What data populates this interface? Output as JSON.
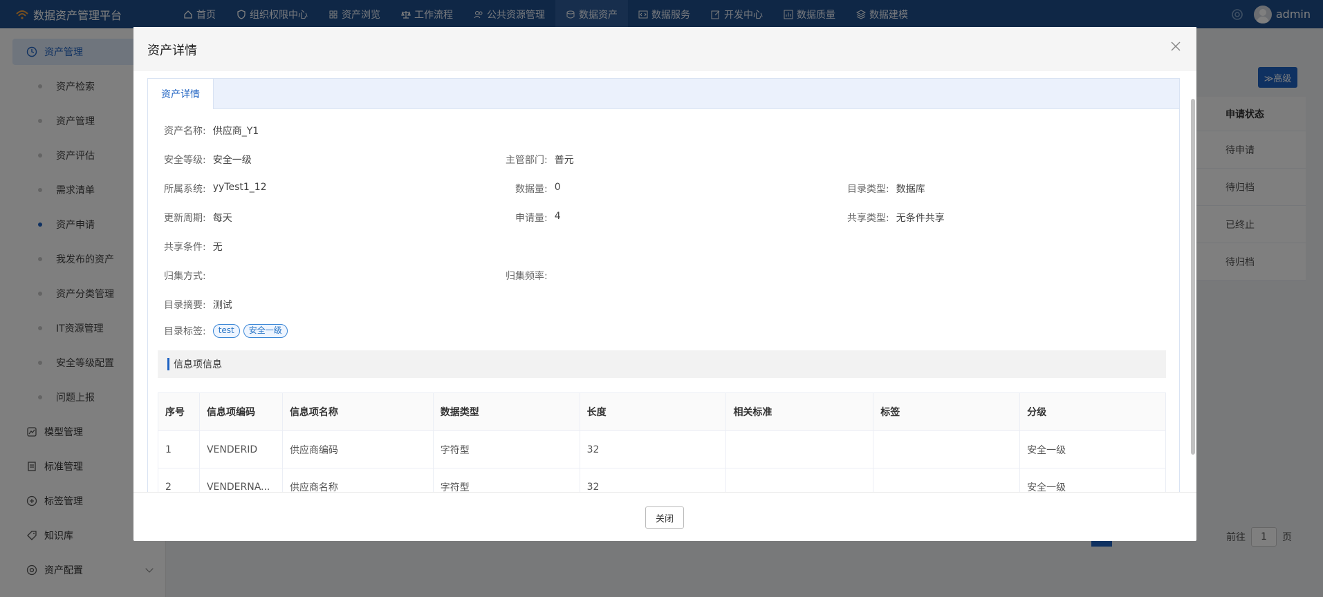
{
  "app": {
    "title": "数据资产管理平台",
    "user": "admin"
  },
  "topnav": [
    {
      "label": "首页",
      "icon": "home-icon"
    },
    {
      "label": "组织权限中心",
      "icon": "shield-icon"
    },
    {
      "label": "资产浏览",
      "icon": "grid-icon"
    },
    {
      "label": "工作流程",
      "icon": "scale-icon"
    },
    {
      "label": "公共资源管理",
      "icon": "users-icon"
    },
    {
      "label": "数据资产",
      "icon": "database-icon",
      "active": true
    },
    {
      "label": "数据服务",
      "icon": "code-icon"
    },
    {
      "label": "开发中心",
      "icon": "edit-icon"
    },
    {
      "label": "数据质量",
      "icon": "chart-icon"
    },
    {
      "label": "数据建模",
      "icon": "layers-icon"
    }
  ],
  "sidebar": {
    "group_active": "资产管理",
    "subitems": [
      "资产检索",
      "资产管理",
      "资产评估",
      "需求清单",
      "资产申请",
      "我发布的资产",
      "资产分类管理",
      "IT资源管理",
      "安全等级配置",
      "问题上报"
    ],
    "groups": [
      "模型管理",
      "标准管理",
      "标签管理",
      "知识库",
      "资产配置"
    ]
  },
  "background": {
    "advanced_label": "≫高级",
    "status_header": "申请状态",
    "statuses": [
      "待申请",
      "待归档",
      "已终止",
      "待归档"
    ],
    "pager_goto": "前往",
    "pager_page": "1",
    "pager_suffix": "页"
  },
  "modal": {
    "title": "资产详情",
    "tab": "资产详情",
    "close_button": "关闭",
    "fields": {
      "name_label": "资产名称:",
      "name_value": "供应商_Y1",
      "security_label": "安全等级:",
      "security_value": "安全一级",
      "dept_label": "主管部门:",
      "dept_value": "普元",
      "system_label": "所属系统:",
      "system_value": "yyTest1_12",
      "datacount_label": "数据量:",
      "datacount_value": "0",
      "cattype_label": "目录类型:",
      "cattype_value": "数据库",
      "cycle_label": "更新周期:",
      "cycle_value": "每天",
      "apply_label": "申请量:",
      "apply_value": "4",
      "sharetype_label": "共享类型:",
      "sharetype_value": "无条件共享",
      "sharecond_label": "共享条件:",
      "sharecond_value": "无",
      "collect_label": "归集方式:",
      "collect_value": "",
      "freq_label": "归集频率:",
      "freq_value": "",
      "summary_label": "目录摘要:",
      "summary_value": "测试",
      "tags_label": "目录标签:",
      "tags": [
        "test",
        "安全一级"
      ]
    },
    "info_section": "信息项信息",
    "table": {
      "headers": [
        "序号",
        "信息项编码",
        "信息项名称",
        "数据类型",
        "长度",
        "相关标准",
        "标签",
        "分级"
      ],
      "rows": [
        [
          "1",
          "VENDERID",
          "供应商编码",
          "字符型",
          "32",
          "",
          "",
          "安全一级"
        ],
        [
          "2",
          "VENDERNA...",
          "供应商名称",
          "字符型",
          "32",
          "",
          "",
          "安全一级"
        ]
      ]
    }
  }
}
